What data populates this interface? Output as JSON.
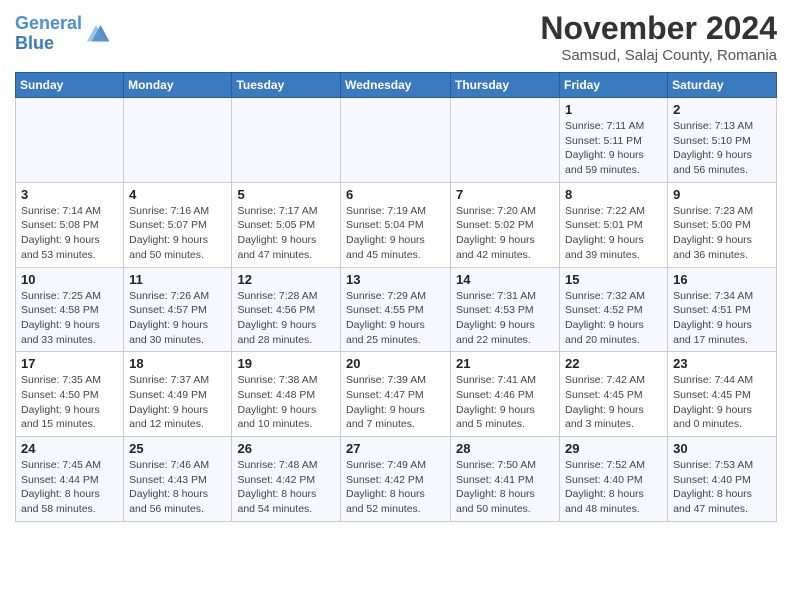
{
  "header": {
    "logo_line1": "General",
    "logo_line2": "Blue",
    "month_title": "November 2024",
    "location": "Samsud, Salaj County, Romania"
  },
  "weekdays": [
    "Sunday",
    "Monday",
    "Tuesday",
    "Wednesday",
    "Thursday",
    "Friday",
    "Saturday"
  ],
  "weeks": [
    [
      {
        "day": "",
        "info": ""
      },
      {
        "day": "",
        "info": ""
      },
      {
        "day": "",
        "info": ""
      },
      {
        "day": "",
        "info": ""
      },
      {
        "day": "",
        "info": ""
      },
      {
        "day": "1",
        "info": "Sunrise: 7:11 AM\nSunset: 5:11 PM\nDaylight: 9 hours and 59 minutes."
      },
      {
        "day": "2",
        "info": "Sunrise: 7:13 AM\nSunset: 5:10 PM\nDaylight: 9 hours and 56 minutes."
      }
    ],
    [
      {
        "day": "3",
        "info": "Sunrise: 7:14 AM\nSunset: 5:08 PM\nDaylight: 9 hours and 53 minutes."
      },
      {
        "day": "4",
        "info": "Sunrise: 7:16 AM\nSunset: 5:07 PM\nDaylight: 9 hours and 50 minutes."
      },
      {
        "day": "5",
        "info": "Sunrise: 7:17 AM\nSunset: 5:05 PM\nDaylight: 9 hours and 47 minutes."
      },
      {
        "day": "6",
        "info": "Sunrise: 7:19 AM\nSunset: 5:04 PM\nDaylight: 9 hours and 45 minutes."
      },
      {
        "day": "7",
        "info": "Sunrise: 7:20 AM\nSunset: 5:02 PM\nDaylight: 9 hours and 42 minutes."
      },
      {
        "day": "8",
        "info": "Sunrise: 7:22 AM\nSunset: 5:01 PM\nDaylight: 9 hours and 39 minutes."
      },
      {
        "day": "9",
        "info": "Sunrise: 7:23 AM\nSunset: 5:00 PM\nDaylight: 9 hours and 36 minutes."
      }
    ],
    [
      {
        "day": "10",
        "info": "Sunrise: 7:25 AM\nSunset: 4:58 PM\nDaylight: 9 hours and 33 minutes."
      },
      {
        "day": "11",
        "info": "Sunrise: 7:26 AM\nSunset: 4:57 PM\nDaylight: 9 hours and 30 minutes."
      },
      {
        "day": "12",
        "info": "Sunrise: 7:28 AM\nSunset: 4:56 PM\nDaylight: 9 hours and 28 minutes."
      },
      {
        "day": "13",
        "info": "Sunrise: 7:29 AM\nSunset: 4:55 PM\nDaylight: 9 hours and 25 minutes."
      },
      {
        "day": "14",
        "info": "Sunrise: 7:31 AM\nSunset: 4:53 PM\nDaylight: 9 hours and 22 minutes."
      },
      {
        "day": "15",
        "info": "Sunrise: 7:32 AM\nSunset: 4:52 PM\nDaylight: 9 hours and 20 minutes."
      },
      {
        "day": "16",
        "info": "Sunrise: 7:34 AM\nSunset: 4:51 PM\nDaylight: 9 hours and 17 minutes."
      }
    ],
    [
      {
        "day": "17",
        "info": "Sunrise: 7:35 AM\nSunset: 4:50 PM\nDaylight: 9 hours and 15 minutes."
      },
      {
        "day": "18",
        "info": "Sunrise: 7:37 AM\nSunset: 4:49 PM\nDaylight: 9 hours and 12 minutes."
      },
      {
        "day": "19",
        "info": "Sunrise: 7:38 AM\nSunset: 4:48 PM\nDaylight: 9 hours and 10 minutes."
      },
      {
        "day": "20",
        "info": "Sunrise: 7:39 AM\nSunset: 4:47 PM\nDaylight: 9 hours and 7 minutes."
      },
      {
        "day": "21",
        "info": "Sunrise: 7:41 AM\nSunset: 4:46 PM\nDaylight: 9 hours and 5 minutes."
      },
      {
        "day": "22",
        "info": "Sunrise: 7:42 AM\nSunset: 4:45 PM\nDaylight: 9 hours and 3 minutes."
      },
      {
        "day": "23",
        "info": "Sunrise: 7:44 AM\nSunset: 4:45 PM\nDaylight: 9 hours and 0 minutes."
      }
    ],
    [
      {
        "day": "24",
        "info": "Sunrise: 7:45 AM\nSunset: 4:44 PM\nDaylight: 8 hours and 58 minutes."
      },
      {
        "day": "25",
        "info": "Sunrise: 7:46 AM\nSunset: 4:43 PM\nDaylight: 8 hours and 56 minutes."
      },
      {
        "day": "26",
        "info": "Sunrise: 7:48 AM\nSunset: 4:42 PM\nDaylight: 8 hours and 54 minutes."
      },
      {
        "day": "27",
        "info": "Sunrise: 7:49 AM\nSunset: 4:42 PM\nDaylight: 8 hours and 52 minutes."
      },
      {
        "day": "28",
        "info": "Sunrise: 7:50 AM\nSunset: 4:41 PM\nDaylight: 8 hours and 50 minutes."
      },
      {
        "day": "29",
        "info": "Sunrise: 7:52 AM\nSunset: 4:40 PM\nDaylight: 8 hours and 48 minutes."
      },
      {
        "day": "30",
        "info": "Sunrise: 7:53 AM\nSunset: 4:40 PM\nDaylight: 8 hours and 47 minutes."
      }
    ]
  ]
}
